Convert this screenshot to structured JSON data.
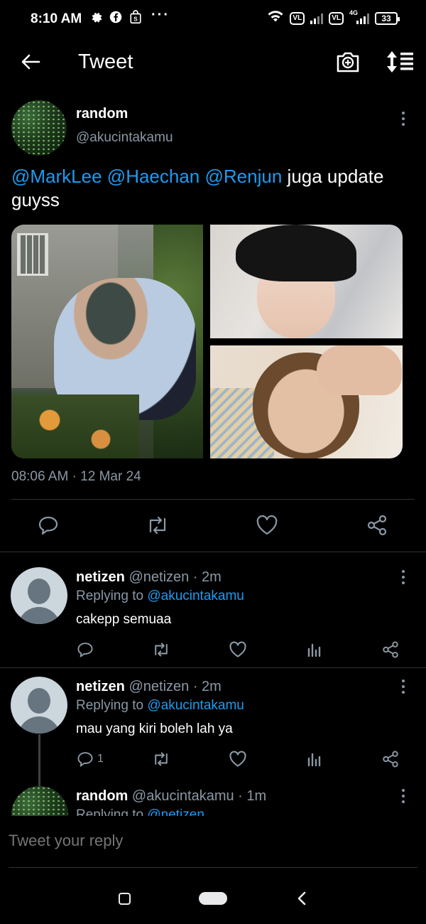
{
  "status_bar": {
    "time": "8:10 AM",
    "left_icons": [
      "gear-icon",
      "facebook-icon",
      "shopee-icon"
    ],
    "more": "···",
    "volte1": "VL",
    "volte2": "VL",
    "network": "4G",
    "battery": "33"
  },
  "header": {
    "title": "Tweet",
    "back_icon": "arrow-left-icon",
    "camera_icon": "camera-plus-icon",
    "sort_icon": "sort-icon"
  },
  "main_tweet": {
    "name": "random",
    "handle": "@akucintakamu",
    "mentions": [
      "@MarkLee",
      "@Haechan",
      "@Renjun"
    ],
    "text_rest": "juga update guyss",
    "timestamp": "08:06 AM · 12 Mar 24"
  },
  "replies": [
    {
      "name": "netizen",
      "meta": "@netizen · 2m",
      "replying_prefix": "Replying to",
      "replying_to": "@akucintakamu",
      "text": "cakepp semuaa",
      "reply_count": ""
    },
    {
      "name": "netizen",
      "meta": "@netizen · 2m",
      "replying_prefix": "Replying to",
      "replying_to": "@akucintakamu",
      "text": "mau yang kiri boleh lah ya",
      "reply_count": "1"
    },
    {
      "name": "random",
      "meta": "@akucintakamu · 1m",
      "replying_prefix": "Replying to",
      "replying_to": "@netizen",
      "text": "",
      "reply_count": ""
    }
  ],
  "composer": {
    "placeholder": "Tweet your reply"
  },
  "colors": {
    "background": "#000000",
    "accent": "#1d9bf0",
    "muted": "#8b98a5",
    "divider": "#2f3336"
  }
}
